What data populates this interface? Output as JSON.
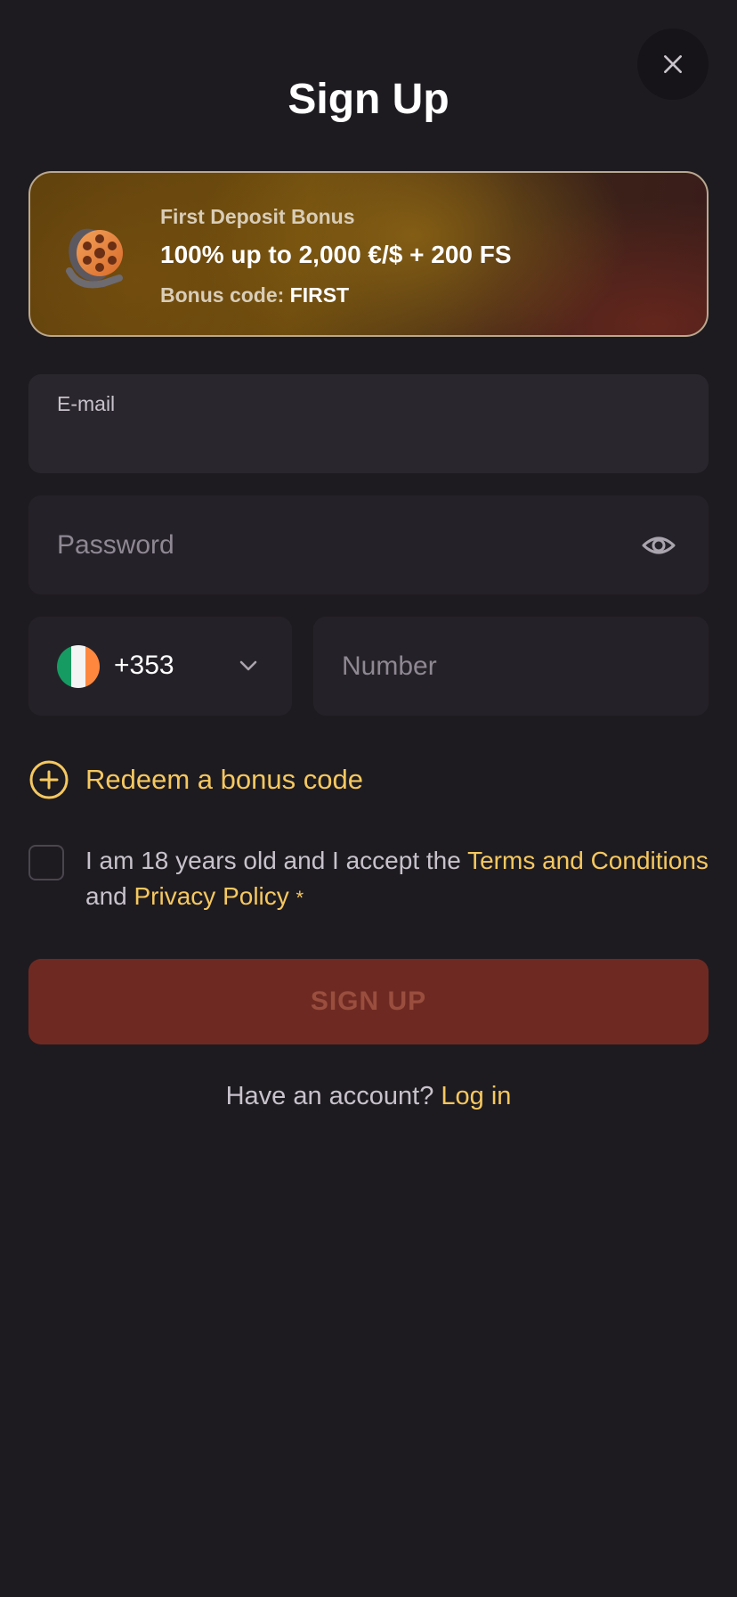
{
  "header": {
    "title": "Sign Up",
    "close_icon": "close-icon"
  },
  "bonus": {
    "label": "First Deposit Bonus",
    "amount": "100% up to 2,000 €/$ + 200 FS",
    "code_prefix": "Bonus code:",
    "code": "FIRST",
    "icon": "film-reel-icon"
  },
  "form": {
    "email_label": "E-mail",
    "email_value": "",
    "password_placeholder": "Password",
    "password_toggle_icon": "eye-icon",
    "country": {
      "dial_code": "+353",
      "flag": "ireland-flag-icon",
      "flag_colors": [
        "#169b62",
        "#ffffff",
        "#ff883e"
      ]
    },
    "number_placeholder": "Number",
    "redeem_label": "Redeem a bonus code",
    "terms": {
      "prefix": "I am 18 years old and I accept the",
      "terms_link": "Terms and Conditions",
      "middle": "and",
      "privacy_link": "Privacy Policy",
      "required_mark": "*"
    },
    "submit_label": "SIGN UP"
  },
  "footer": {
    "prompt": "Have an account?",
    "login_link": "Log in"
  },
  "colors": {
    "background": "#1e1b20",
    "field": "#2a262d",
    "accent": "#f5c860",
    "submit_bg": "#6e2a22",
    "submit_text": "#9a4e3e"
  }
}
